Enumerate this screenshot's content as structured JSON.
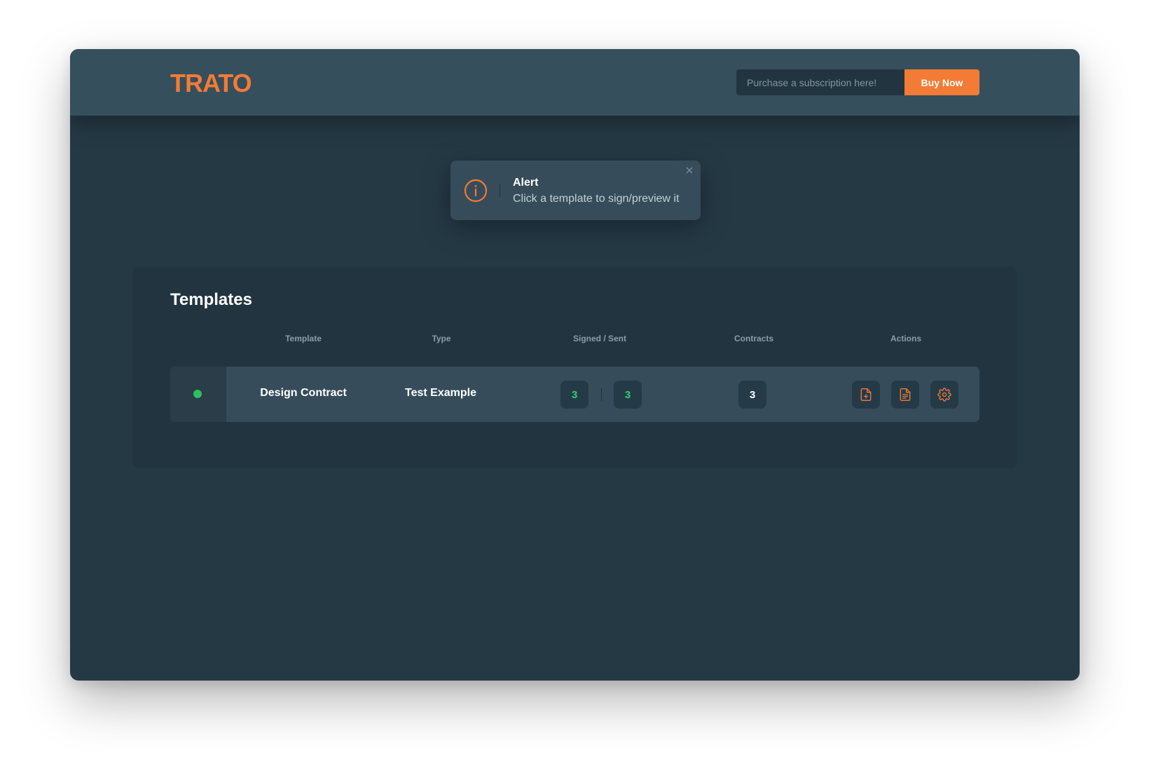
{
  "header": {
    "logo": "TRATO",
    "subscription_placeholder": "Purchase a subscription here!",
    "buy_label": "Buy Now"
  },
  "alert": {
    "title": "Alert",
    "message": "Click a template to sign/preview it",
    "icon": "info-circle-icon",
    "close_icon": "close-icon"
  },
  "templates": {
    "title": "Templates",
    "columns": [
      "Template",
      "Type",
      "Signed / Sent",
      "Contracts",
      "Actions"
    ],
    "rows": [
      {
        "status": "active",
        "template": "Design Contract",
        "type": "Test Example",
        "signed": "3",
        "sent": "3",
        "contracts": "3",
        "actions": [
          "file-plus-icon",
          "file-text-icon",
          "gear-icon"
        ]
      }
    ]
  },
  "colors": {
    "accent": "#f47b35",
    "status_active": "#2ec05e",
    "count_green": "#31d36b",
    "background": "#253945"
  }
}
